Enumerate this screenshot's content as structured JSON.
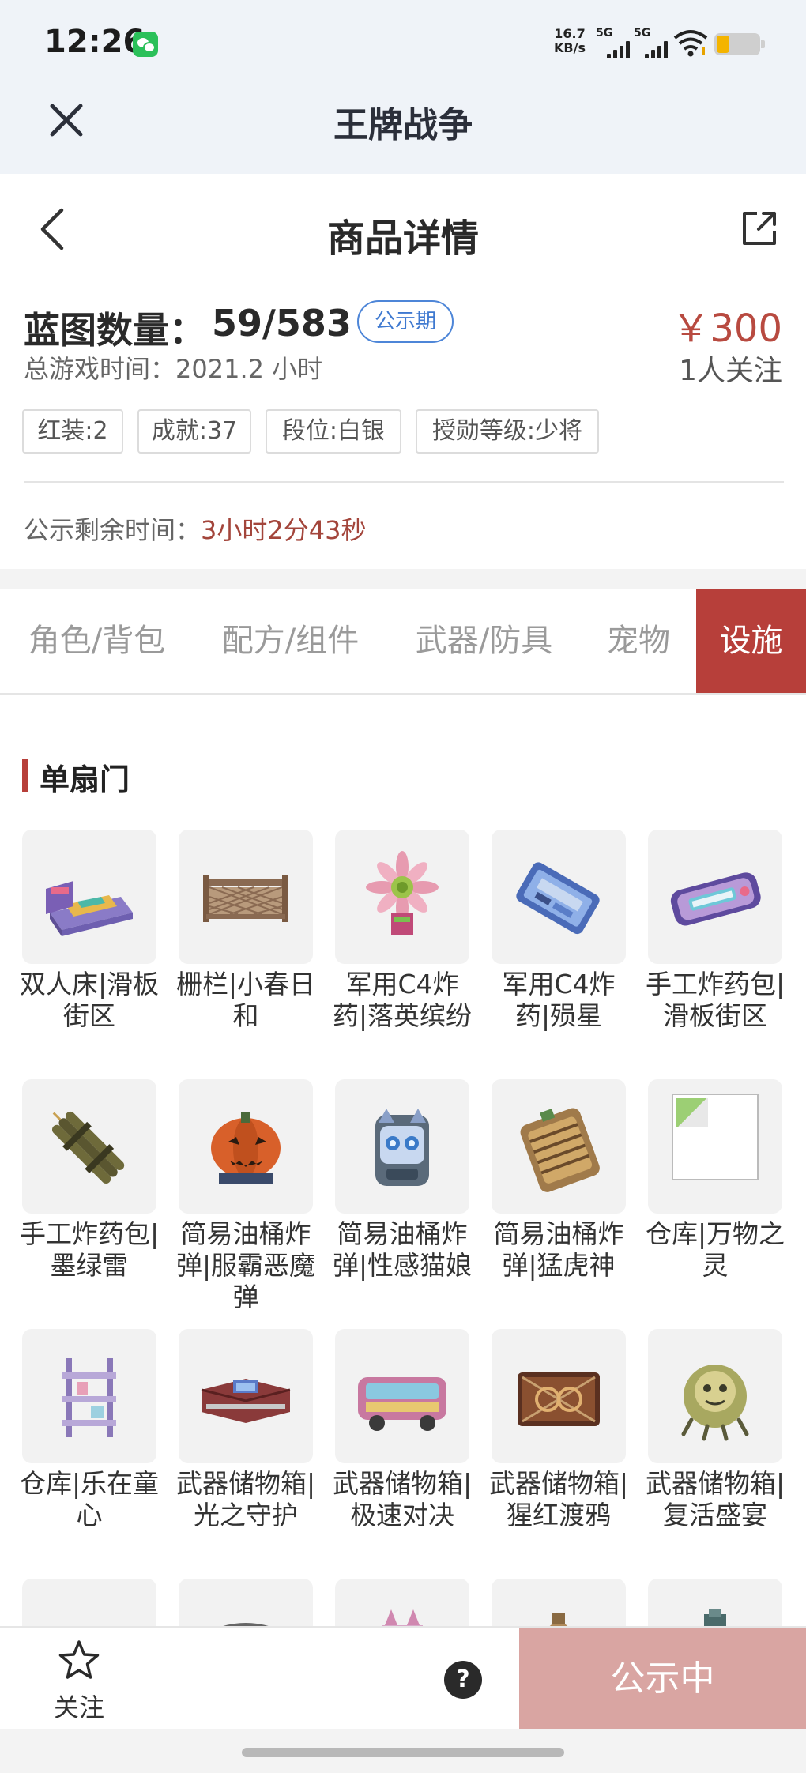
{
  "status_bar": {
    "time": "12:26",
    "net_speed_value": "16.7",
    "net_speed_unit": "KB/s",
    "signal_1": "5G",
    "signal_2": "5G",
    "icons": [
      "wechat-icon",
      "signal-icon",
      "wifi-icon",
      "battery-icon"
    ]
  },
  "app_bar": {
    "title": "王牌战争"
  },
  "nav": {
    "title": "商品详情"
  },
  "summary": {
    "blueprint_label": "蓝图数量：",
    "blueprint_value": "59/583",
    "status_badge": "公示期",
    "price": "￥300",
    "playtime": "总游戏时间：2021.2 小时",
    "followers": "1人关注",
    "tags": [
      "红装:2",
      "成就:37",
      "段位:白银",
      "授勋等级:少将"
    ],
    "countdown_label": "公示剩余时间：",
    "countdown_value": "3小时2分43秒"
  },
  "tabs": [
    {
      "label": "角色/背包",
      "active": false
    },
    {
      "label": "配方/组件",
      "active": false
    },
    {
      "label": "武器/防具",
      "active": false
    },
    {
      "label": "宠物",
      "active": false
    },
    {
      "label": "设施",
      "active": true
    }
  ],
  "section": {
    "title": "单扇门",
    "items": [
      {
        "name": "双人床|滑板街区"
      },
      {
        "name": "栅栏|小春日和"
      },
      {
        "name": "军用C4炸药|落英缤纷"
      },
      {
        "name": "军用C4炸药|殒星"
      },
      {
        "name": "手工炸药包|滑板街区"
      },
      {
        "name": "手工炸药包|墨绿雷"
      },
      {
        "name": "简易油桶炸弹|服霸恶魔弹"
      },
      {
        "name": "简易油桶炸弹|性感猫娘"
      },
      {
        "name": "简易油桶炸弹|猛虎神"
      },
      {
        "name": "仓库|万物之灵"
      },
      {
        "name": "仓库|乐在童心"
      },
      {
        "name": "武器储物箱|光之守护"
      },
      {
        "name": "武器储物箱|极速对决"
      },
      {
        "name": "武器储物箱|猩红渡鸦"
      },
      {
        "name": "武器储物箱|复活盛宴"
      }
    ]
  },
  "bottom_bar": {
    "follow_label": "关注",
    "help_symbol": "?",
    "primary_button": "公示中"
  },
  "colors": {
    "accent_red": "#b73f3a",
    "price_red": "#b84a40",
    "badge_blue": "#4e86d8",
    "disabled_button": "#d9a5a2",
    "header_bg": "#eff3f8"
  }
}
